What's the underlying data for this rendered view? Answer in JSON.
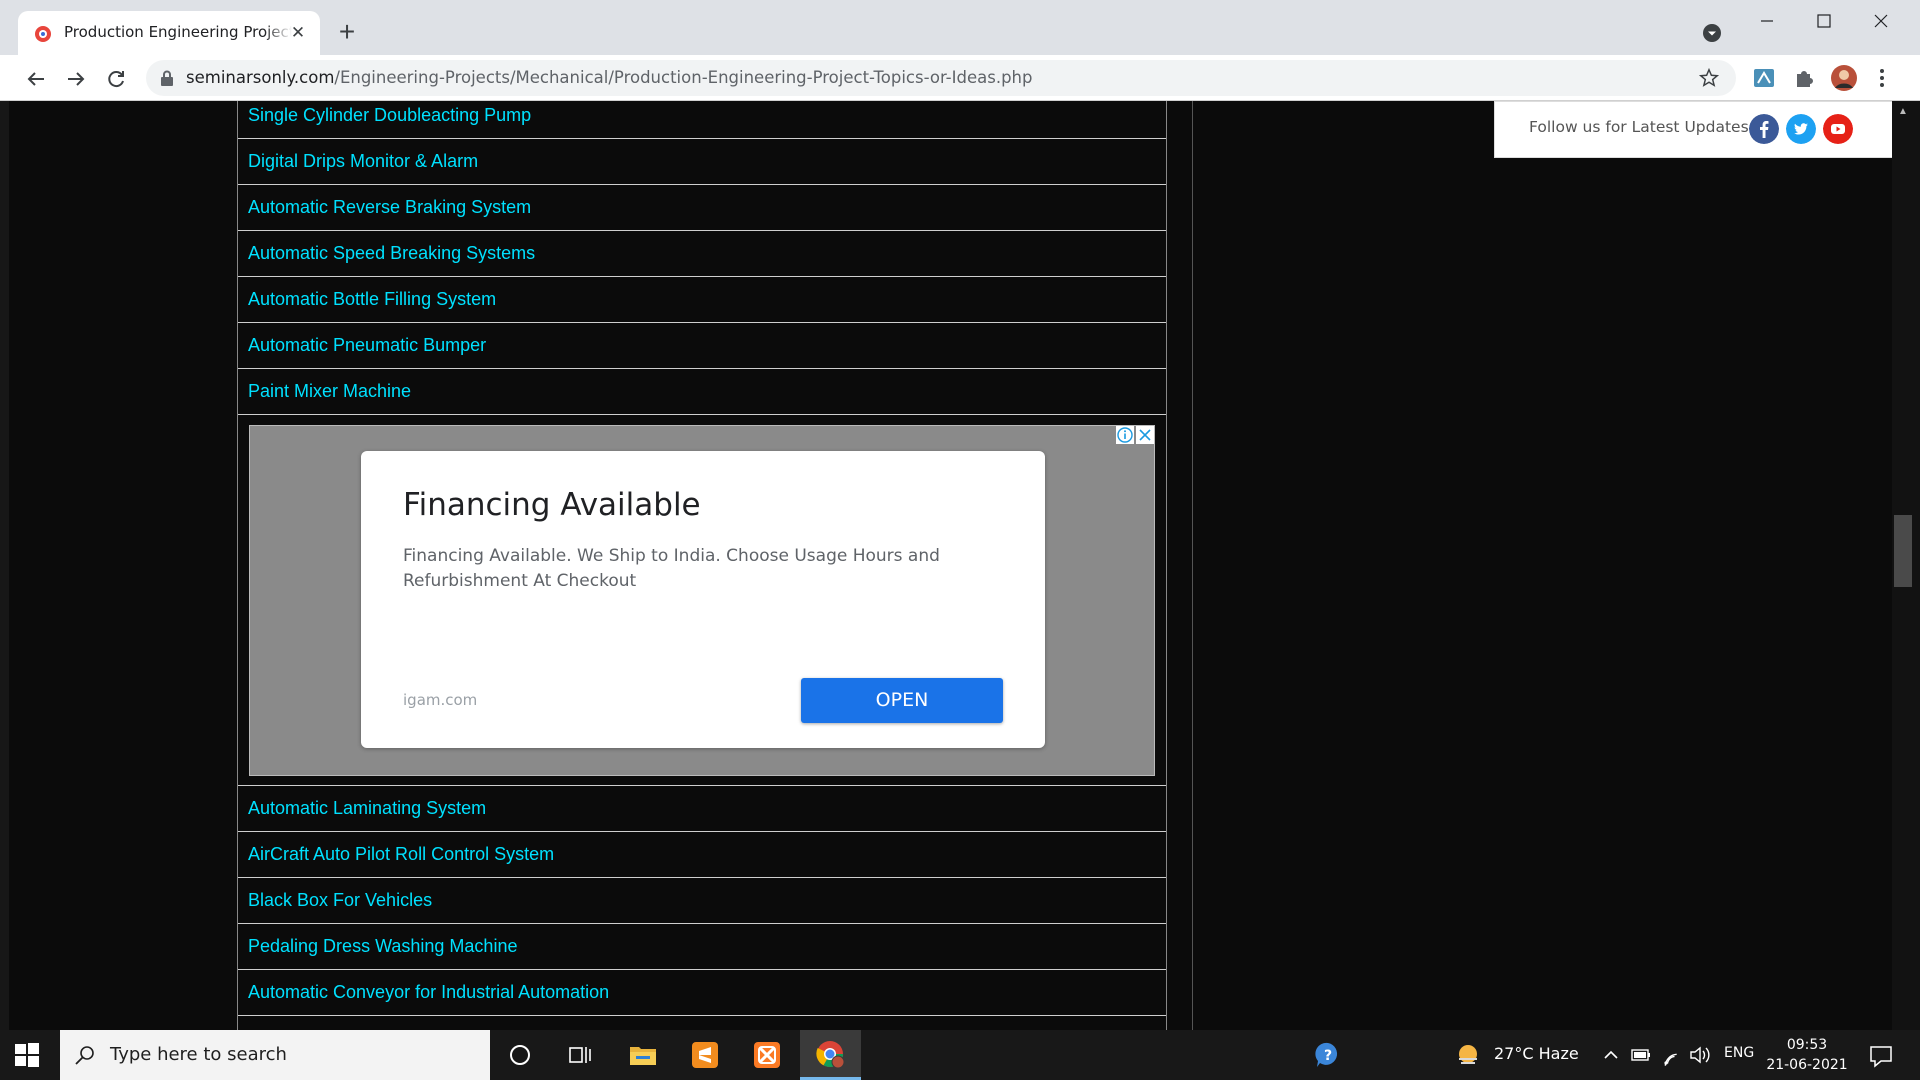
{
  "browser": {
    "tab_title": "Production Engineering Project Topics",
    "url_host": "seminarsonly.com",
    "url_path": "/Engineering-Projects/Mechanical/Production-Engineering-Project-Topics-or-Ideas.php"
  },
  "projects_top": [
    "Single Cylinder Doubleacting Pump",
    "Digital Drips Monitor & Alarm",
    "Automatic Reverse Braking System",
    "Automatic Speed Breaking Systems",
    "Automatic Bottle Filling System",
    "Automatic Pneumatic Bumper",
    "Paint Mixer Machine"
  ],
  "ad": {
    "title": "Financing Available",
    "body": "Financing Available. We Ship to India. Choose Usage Hours and Refurbishment At Checkout",
    "domain": "igam.com",
    "button": "OPEN"
  },
  "projects_bottom": [
    "Automatic Laminating System",
    "AirCraft Auto Pilot Roll Control System",
    "Black Box For Vehicles",
    "Pedaling Dress Washing Machine",
    "Automatic Conveyor for Industrial Automation"
  ],
  "sidebar": {
    "follow_text": "Follow us for Latest Updates",
    "colors": {
      "facebook": "#3b5998",
      "twitter": "#1da1f2",
      "youtube": "#e62117"
    }
  },
  "taskbar": {
    "search_placeholder": "Type here to search",
    "weather": "27°C  Haze",
    "language": "ENG",
    "time": "09:53",
    "date": "21-06-2021"
  },
  "colors": {
    "link": "#00e1ff",
    "ad_button": "#1a73e8",
    "page_bg": "#0b0b0b"
  }
}
